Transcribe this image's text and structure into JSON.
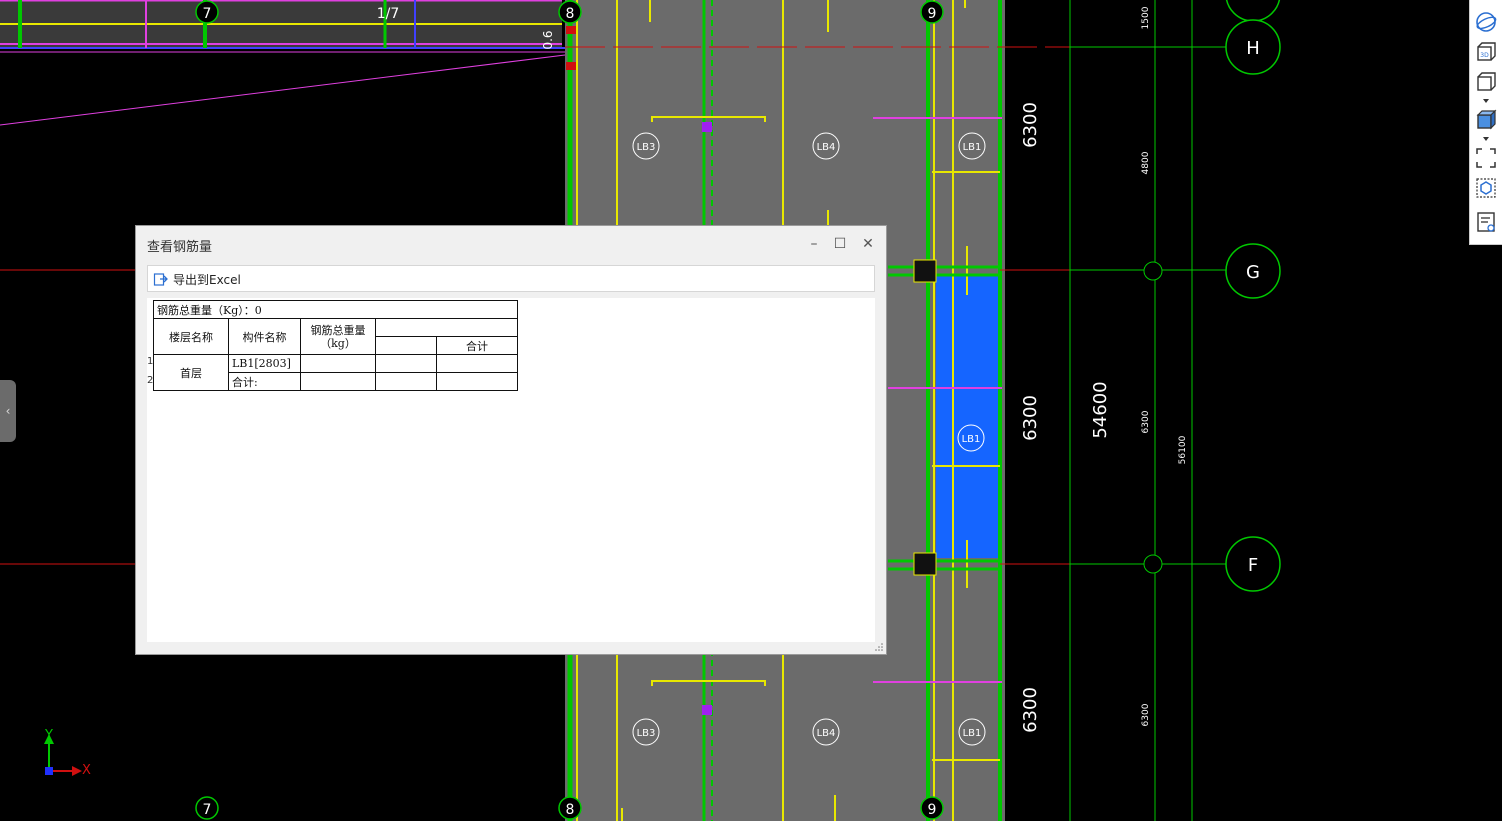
{
  "drawing": {
    "axis_bubbles_bottom": [
      "7",
      "8",
      "9"
    ],
    "axis_bubbles_top": [
      "7",
      "1/7",
      "8",
      "9"
    ],
    "axis_bubbles_right": [
      "H",
      "G",
      "F"
    ],
    "dim_6300": "6300",
    "dim_54600": "54600",
    "dim_small_1500": "1500",
    "dim_small_4800": "4800",
    "dim_small_6300": "6300",
    "dim_small_56100": "56100",
    "note_06": "0.6",
    "slab_labels": [
      "LB3",
      "LB4",
      "LB1"
    ],
    "slab_label_mid": "LB1",
    "colors": {
      "grid_green": "#00c800",
      "axis_red": "#d01010",
      "beam_yellow": "#e8e800",
      "magenta": "#e040e0",
      "slab_gray": "#6b6b6b",
      "highlight_blue": "#1565ff",
      "cyan": "#00c8c8"
    }
  },
  "toolbar": {
    "icons": [
      "sphere-view-icon",
      "3d-view-icon",
      "box-view-icon",
      "solid-box-icon",
      "fullscreen-icon",
      "cube-select-icon",
      "list-settings-icon"
    ]
  },
  "dialog": {
    "title": "查看钢筋量",
    "export_label": "导出到Excel",
    "table": {
      "total_weight": "钢筋总重量（Kg）：0",
      "col_floor": "楼层名称",
      "col_component": "构件名称",
      "col_total": "钢筋总重量\n（kg）",
      "col_sum": "合计",
      "row_numbers": [
        "1",
        "2"
      ],
      "floor_value": "首层",
      "component_1": "LB1[2803]",
      "component_2": "合计:"
    }
  },
  "axis": {
    "y_label": "Y",
    "x_label": "X"
  }
}
